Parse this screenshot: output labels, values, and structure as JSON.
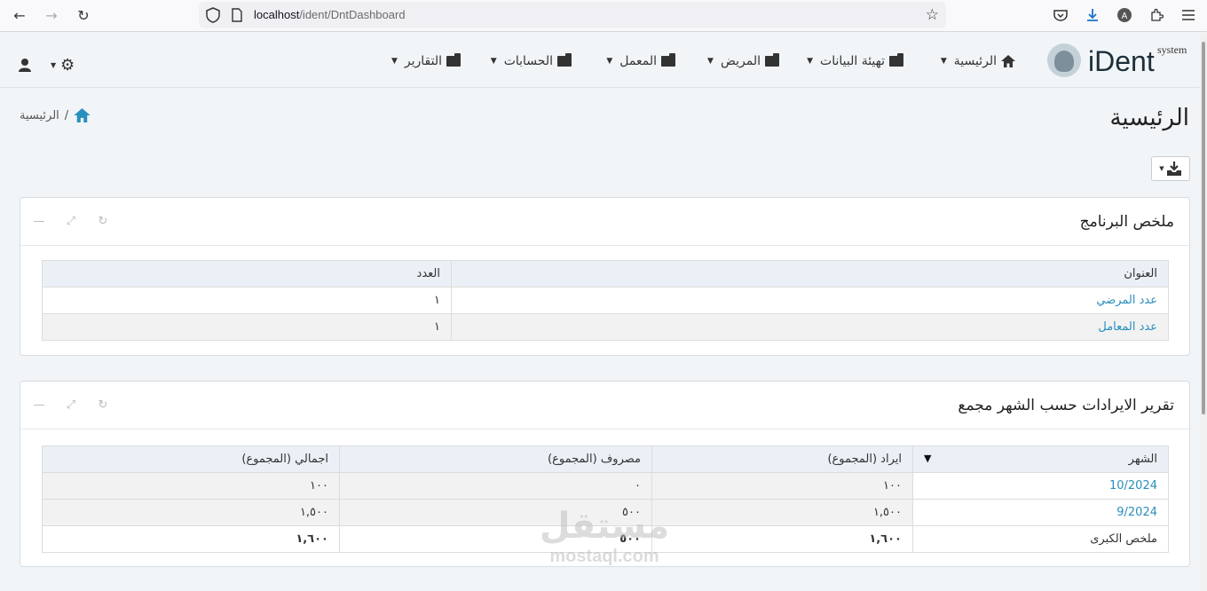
{
  "browser": {
    "url_host": "localhost",
    "url_path": "/ident/DntDashboard"
  },
  "logo": {
    "brand": "iDent",
    "suffix": "system"
  },
  "menu": [
    {
      "label": "الرئيسية",
      "icon": "home-icon"
    },
    {
      "label": "تهيئة البيانات",
      "icon": "folder-icon"
    },
    {
      "label": "المريض",
      "icon": "folder-icon"
    },
    {
      "label": "المعمل",
      "icon": "folder-icon"
    },
    {
      "label": "الحسابات",
      "icon": "folder-icon"
    },
    {
      "label": "التقارير",
      "icon": "folder-icon"
    }
  ],
  "page": {
    "title": "الرئيسية",
    "breadcrumb": "الرئيسية",
    "breadcrumb_sep": "/"
  },
  "summary": {
    "title": "ملخص البرنامج",
    "headers": [
      "العنوان",
      "العدد"
    ],
    "rows": [
      {
        "label": "عدد المرضي",
        "value": "١"
      },
      {
        "label": "عدد المعامل",
        "value": "١"
      }
    ]
  },
  "revenue": {
    "title": "تقرير الايرادات حسب الشهر مجمع",
    "headers": [
      "الشهر",
      "ايراد (المجموع)",
      "مصروف (المجموع)",
      "اجمالي (المجموع)"
    ],
    "rows": [
      {
        "month": "10/2024",
        "income": "١٠٠",
        "expense": "٠",
        "total": "١٠٠"
      },
      {
        "month": "9/2024",
        "income": "١,٥٠٠",
        "expense": "٥٠٠",
        "total": "١,٥٠٠"
      }
    ],
    "grand": {
      "month": "ملخص الكبرى",
      "income": "١,٦٠٠",
      "expense": "٥٠٠",
      "total": "١,٦٠٠"
    }
  },
  "watermark": {
    "arabic": "مستقل",
    "latin": "mostaql.com"
  },
  "colors": {
    "link": "#2a8fbd",
    "header_bg": "#eaf0f5",
    "page_bg": "#f1f5f8"
  }
}
